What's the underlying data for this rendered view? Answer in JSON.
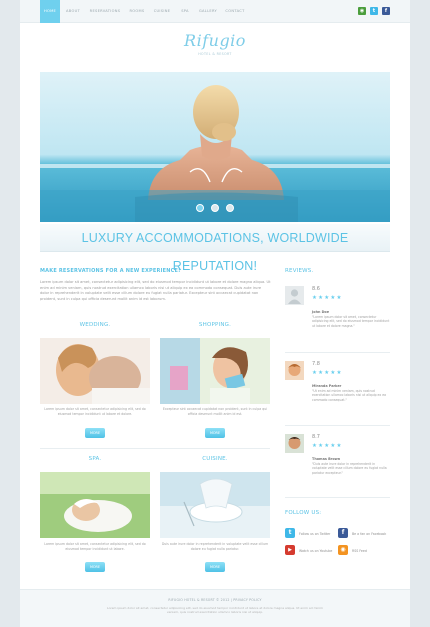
{
  "nav": {
    "items": [
      "Home",
      "About",
      "Reservations",
      "Rooms",
      "Cuisine",
      "Spa",
      "Gallery",
      "Contact"
    ],
    "social": [
      "rss-icon",
      "twitter-icon",
      "facebook-icon"
    ]
  },
  "logo": {
    "title": "Rifugio",
    "subtitle": "Hotel & Resort"
  },
  "hero": {
    "slides": 3,
    "active_slide": 1
  },
  "banner": {
    "text": "Luxury Accommodations, Worldwide Reputation!"
  },
  "main": {
    "title": "Make reservations for a new experience!",
    "intro": "Lorem ipsum dolor sit amet, consectetur adipisicing elit, sed do eiusmod tempor incididunt ut labore et dolore magna aliqua. Ut enim ad minim veniam, quis nostrud exercitation ullamco laboris nisi ut aliquip ex ea commodo consequat. Duis aute irure dolor in reprehenderit in voluptate velit esse cillum dolore eu fugiat nulla pariatur. Excepteur sint occaecat cupidatat non proident, sunt in culpa qui officia deserunt mollit anim id est laborum.",
    "features": [
      {
        "title": "Wedding.",
        "text": "Lorem ipsum dolor sit amet, consectetur adipisicing elit, sed do eiusmod tempor incididunt ut labore et dolore.",
        "button": "More"
      },
      {
        "title": "Shopping.",
        "text": "Excepteur sint occaecat cupidatat non proident, sunt in culpa qui officia deserunt mollit anim id est.",
        "button": "More"
      },
      {
        "title": "Spa.",
        "text": "Lorem ipsum dolor sit amet, consectetur adipisicing elit, sed do eiusmod tempor incididunt ut labore.",
        "button": "More"
      },
      {
        "title": "Cuisine.",
        "text": "Duis aute irure dolor in reprehenderit in voluptate velit esse cillum dolore eu fugiat nulla pariatur.",
        "button": "More"
      }
    ]
  },
  "reviews": {
    "title": "Reviews.",
    "items": [
      {
        "score": "8.6",
        "stars": "★★★★★",
        "name": "John Doe",
        "text": "\"Lorem ipsum dolor sit amet, consectetur adipisicing elit, sed do eiusmod tempor incididunt ut labore et dolore magna.\""
      },
      {
        "score": "7.8",
        "stars": "★★★★★",
        "name": "Miranda Parker",
        "text": "\"Ut enim ad minim veniam, quis nostrud exercitation ullamco laboris nisi ut aliquip ex ea commodo consequat.\""
      },
      {
        "score": "8.7",
        "stars": "★★★★★",
        "name": "Thomas Brown",
        "text": "\"Duis aute irure dolor in reprehenderit in voluptate velit esse cillum dolore eu fugiat nulla pariatur excepteur.\""
      }
    ]
  },
  "follow": {
    "title": "Follow us:",
    "items": [
      {
        "icon": "twitter-icon",
        "label": "Follow us on Twitter",
        "color": "#3fb8e8",
        "glyph": "t"
      },
      {
        "icon": "facebook-icon",
        "label": "Be a fan on Facebook",
        "color": "#3b5a98",
        "glyph": "f"
      },
      {
        "icon": "youtube-icon",
        "label": "Watch us on Youtube",
        "color": "#d53b2f",
        "glyph": "▶"
      },
      {
        "icon": "rss-icon",
        "label": "RSS Feed",
        "color": "#f39321",
        "glyph": "◉"
      }
    ]
  },
  "footer": {
    "links": "Rifugio Hotel & Resort © 2012  |  Privacy Policy",
    "text": "Lorem ipsum dolor sit amet, consectetur adipisicing elit, sed do eiusmod tempor incididunt ut labore et dolore magna aliqua. Ut enim ad minim veniam, quis nostrud exercitation ullamco laboris nisi ut aliquip."
  },
  "colors": {
    "accent": "#5cc3e5",
    "nav_active": "#6fd0ee",
    "page_bg": "#e3e9ed"
  }
}
